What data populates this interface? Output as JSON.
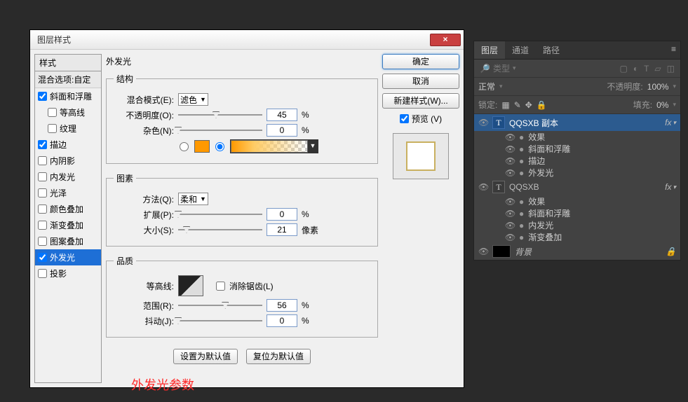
{
  "dialog": {
    "title": "图层样式",
    "styles_header": "样式",
    "blend_options": "混合选项:自定",
    "items": [
      {
        "label": "斜面和浮雕",
        "checked": true
      },
      {
        "label": "等高线",
        "checked": false,
        "indent": true
      },
      {
        "label": "纹理",
        "checked": false,
        "indent": true
      },
      {
        "label": "描边",
        "checked": true
      },
      {
        "label": "内阴影",
        "checked": false
      },
      {
        "label": "内发光",
        "checked": false
      },
      {
        "label": "光泽",
        "checked": false
      },
      {
        "label": "颜色叠加",
        "checked": false
      },
      {
        "label": "渐变叠加",
        "checked": false
      },
      {
        "label": "图案叠加",
        "checked": false
      },
      {
        "label": "外发光",
        "checked": true,
        "selected": true
      },
      {
        "label": "投影",
        "checked": false
      }
    ],
    "panel_title": "外发光",
    "structure": {
      "legend": "结构",
      "blend_mode_label": "混合模式(E):",
      "blend_mode_value": "滤色",
      "opacity_label": "不透明度(O):",
      "opacity_value": "45",
      "pct": "%",
      "noise_label": "杂色(N):",
      "noise_value": "0"
    },
    "elements": {
      "legend": "图素",
      "technique_label": "方法(Q):",
      "technique_value": "柔和",
      "spread_label": "扩展(P):",
      "spread_value": "0",
      "pct": "%",
      "size_label": "大小(S):",
      "size_value": "21",
      "px": "像素"
    },
    "quality": {
      "legend": "品质",
      "contour_label": "等高线:",
      "antialias": "消除锯齿(L)",
      "range_label": "范围(R):",
      "range_value": "56",
      "pct": "%",
      "jitter_label": "抖动(J):",
      "jitter_value": "0"
    },
    "buttons": {
      "set_default": "设置为默认值",
      "reset_default": "复位为默认值",
      "ok": "确定",
      "cancel": "取消",
      "new_style": "新建样式(W)...",
      "preview": "预览 (V)"
    },
    "annotation": "外发光参数"
  },
  "panel": {
    "tabs": {
      "layers": "图层",
      "channels": "通道",
      "paths": "路径"
    },
    "type_filter": "类型",
    "mode": "正常",
    "opacity_label": "不透明度:",
    "opacity_value": "100%",
    "lock_label": "锁定:",
    "fill_label": "填充:",
    "fill_value": "0%",
    "layers": [
      {
        "name": "QQSXB 副本",
        "fx": true,
        "selected": true,
        "effects_label": "效果",
        "effects": [
          "斜面和浮雕",
          "描边",
          "外发光"
        ]
      },
      {
        "name": "QQSXB",
        "fx": true,
        "effects_label": "效果",
        "effects": [
          "斜面和浮雕",
          "内发光",
          "渐变叠加"
        ]
      }
    ],
    "background": "背景"
  }
}
